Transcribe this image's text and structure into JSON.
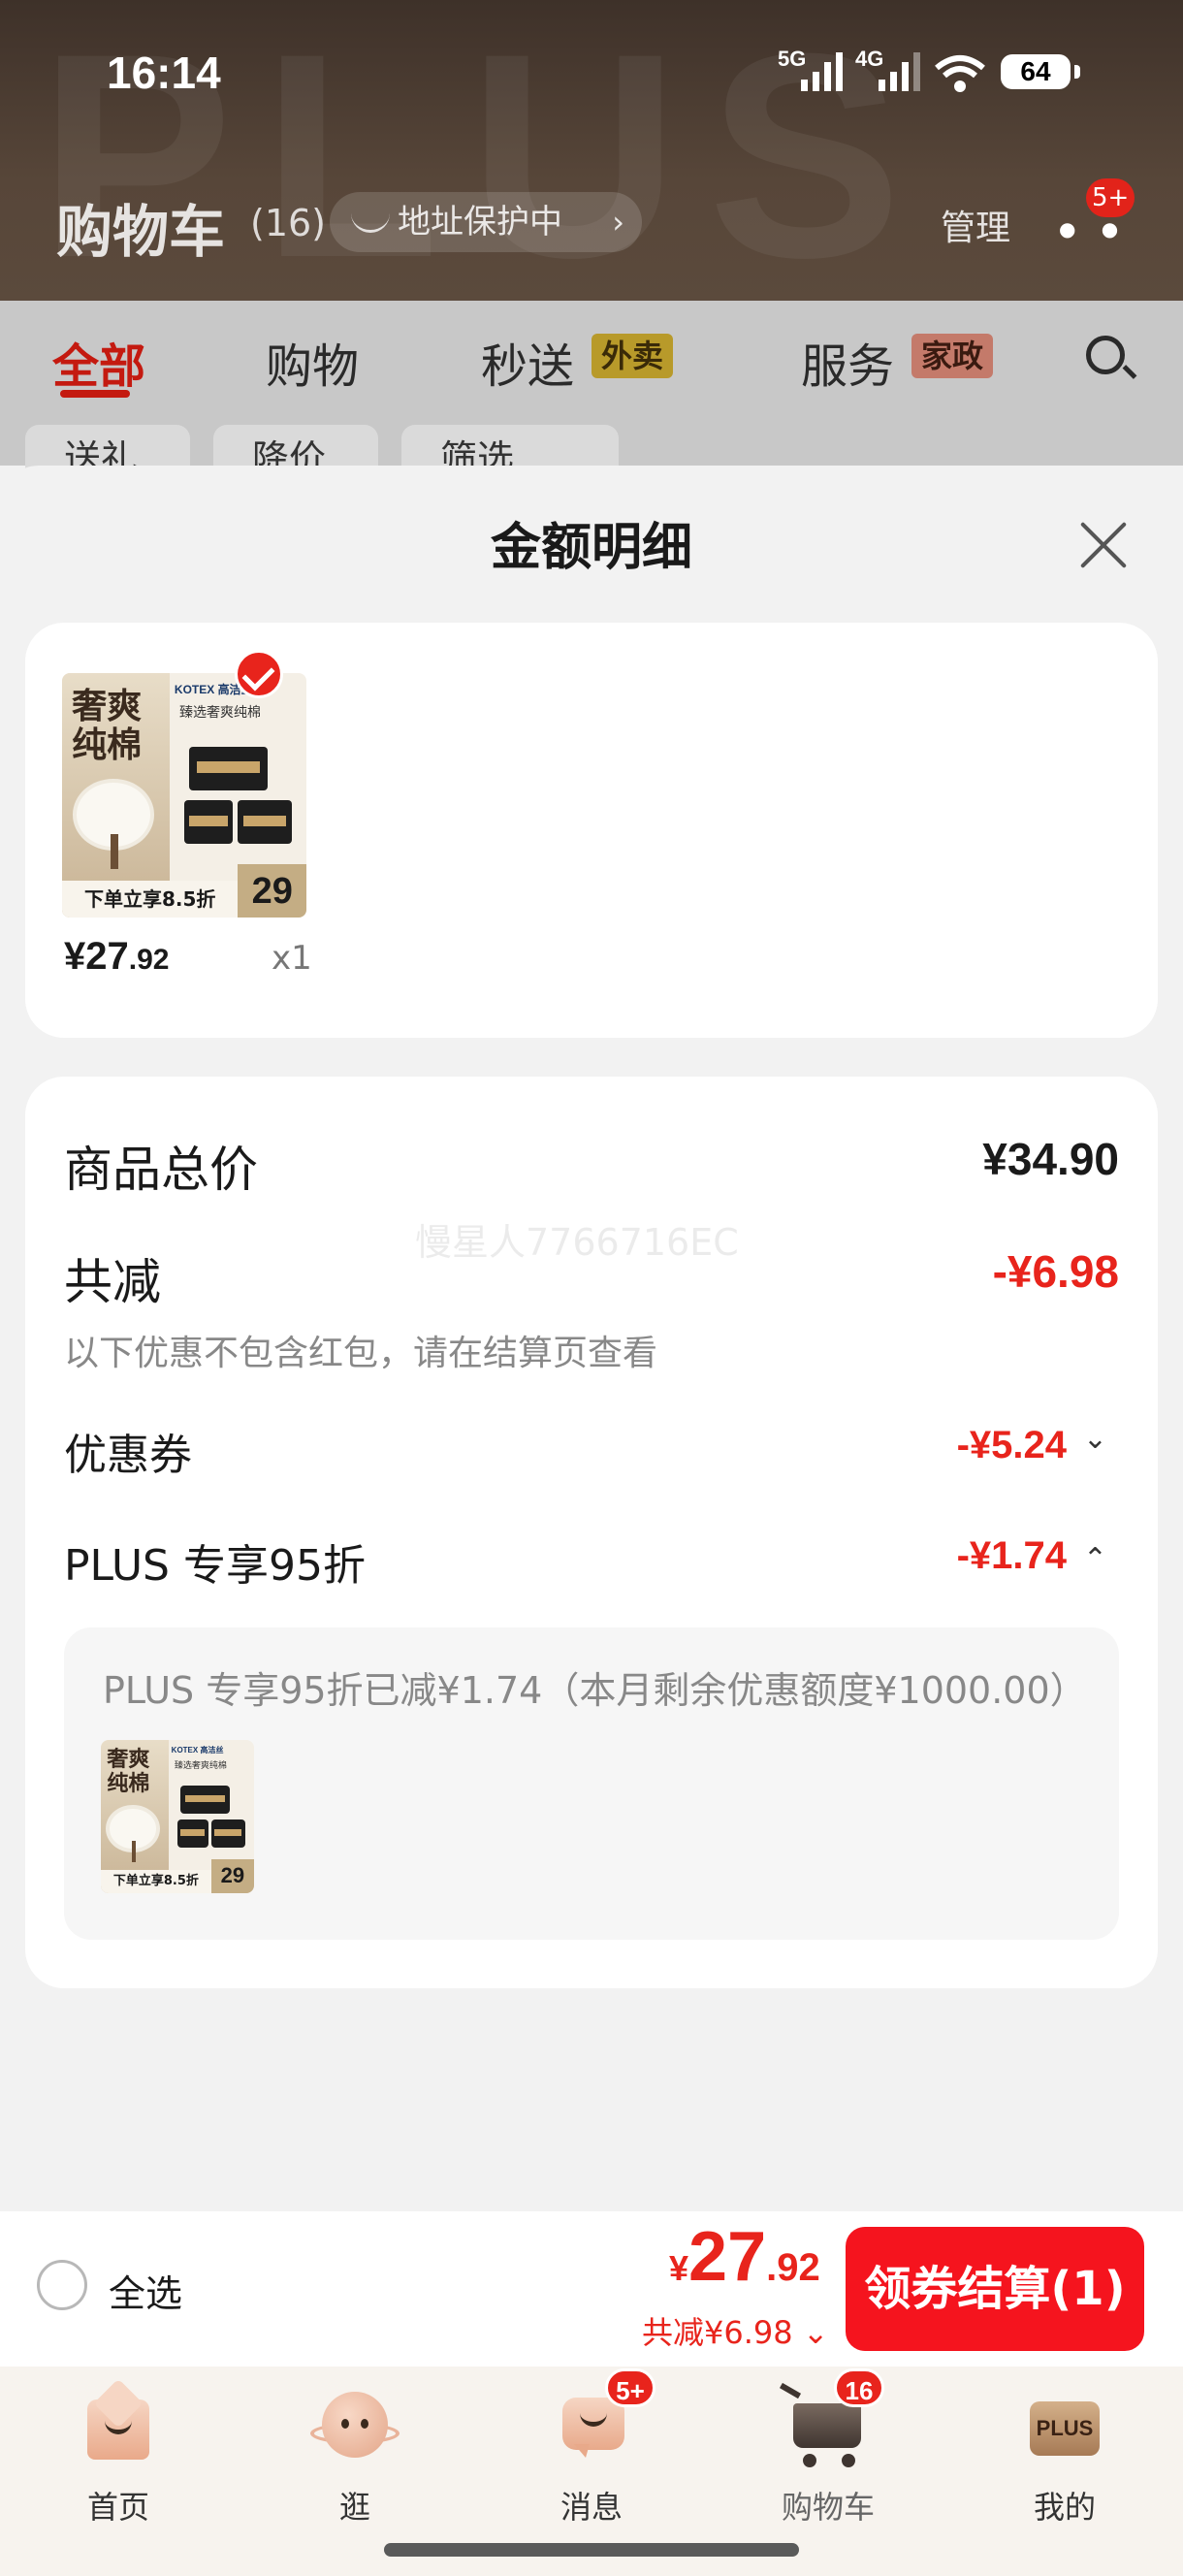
{
  "status_bar": {
    "time": "16:14",
    "signal1_label": "5G",
    "signal2_label": "4G",
    "battery": "64"
  },
  "background_page": {
    "title": "购物车",
    "count": "(16)",
    "address_pill": "地址保护中",
    "manage": "管理",
    "more_badge": "5+",
    "tabs": [
      {
        "label": "全部"
      },
      {
        "label": "购物"
      },
      {
        "label": "秒送",
        "tag": "外卖"
      },
      {
        "label": "服务",
        "tag": "家政"
      }
    ],
    "chips": [
      "送礼",
      "降价",
      "筛选"
    ]
  },
  "sheet": {
    "title": "金额明细",
    "product": {
      "thumb_title": "奢爽纯棉",
      "thumb_brand": "KOTEX 高洁丝",
      "thumb_sub": "臻选奢爽纯棉",
      "thumb_promo": "下单立享8.5折",
      "thumb_price": "29",
      "price_int": "¥27",
      "price_dec": ".92",
      "qty": "x1"
    },
    "watermark": "慢星人7766716EC",
    "rows": {
      "total_label": "商品总价",
      "total_value": "¥34.90",
      "reduce_label": "共减",
      "reduce_value": "-¥6.98",
      "reduce_note": "以下优惠不包含红包，请在结算页查看",
      "coupon_label": "优惠券",
      "coupon_value": "-¥5.24",
      "plus_label": "PLUS 专享95折",
      "plus_value": "-¥1.74",
      "plus_detail": "PLUS 专享95折已减¥1.74（本月剩余优惠额度¥1000.00）"
    }
  },
  "checkout": {
    "select_all": "全选",
    "currency": "¥",
    "total_int": "27",
    "total_dec": ".92",
    "discount": "共减¥6.98",
    "button": "领券结算(1)"
  },
  "nav": {
    "items": [
      {
        "label": "首页"
      },
      {
        "label": "逛"
      },
      {
        "label": "消息",
        "badge": "5+"
      },
      {
        "label": "购物车",
        "badge": "16"
      },
      {
        "label": "我的",
        "tile": "PLUS"
      }
    ]
  },
  "colors": {
    "accent_red": "#e8241c",
    "checkout_red": "#f5141e",
    "header_brown": "#4a3b30"
  }
}
